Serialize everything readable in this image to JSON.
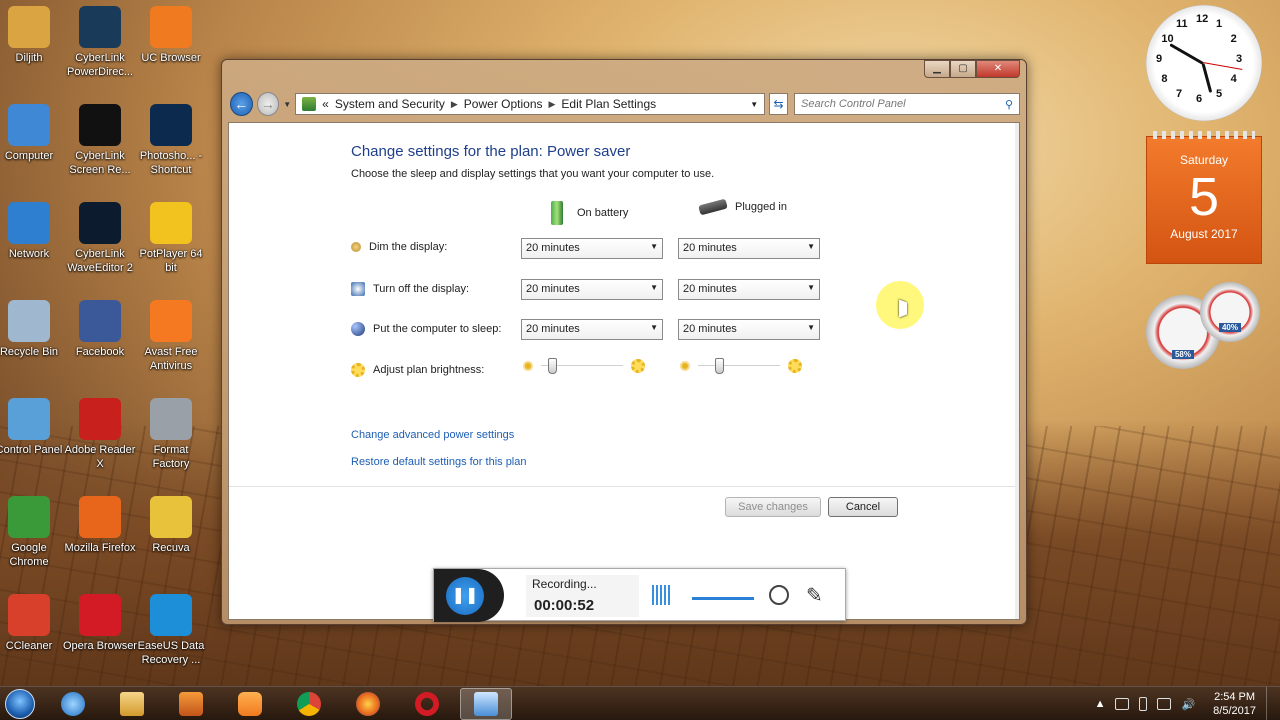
{
  "desktop": {
    "icons": [
      {
        "label": "Diljith",
        "color": "#d9a441"
      },
      {
        "label": "CyberLink PowerDirec...",
        "color": "#1a3a5a"
      },
      {
        "label": "UC Browser",
        "color": "#f07a1f"
      },
      {
        "label": "Computer",
        "color": "#3f88d6"
      },
      {
        "label": "CyberLink Screen Re...",
        "color": "#111111"
      },
      {
        "label": "Photosho... - Shortcut",
        "color": "#0b2a4d"
      },
      {
        "label": "Network",
        "color": "#2f7fd0"
      },
      {
        "label": "CyberLink WaveEditor 2",
        "color": "#0d1b2f"
      },
      {
        "label": "PotPlayer 64 bit",
        "color": "#f2c21f"
      },
      {
        "label": "Recycle Bin",
        "color": "#9fb7cf"
      },
      {
        "label": "Facebook",
        "color": "#3b5998"
      },
      {
        "label": "Avast Free Antivirus",
        "color": "#f47920"
      },
      {
        "label": "Control Panel",
        "color": "#5aa0d8"
      },
      {
        "label": "Adobe Reader X",
        "color": "#c8211d"
      },
      {
        "label": "Format Factory",
        "color": "#9aa0a8"
      },
      {
        "label": "Google Chrome",
        "color": "#3a9a3a"
      },
      {
        "label": "Mozilla Firefox",
        "color": "#e8661c"
      },
      {
        "label": "Recuva",
        "color": "#e8c23a"
      },
      {
        "label": "CCleaner",
        "color": "#d8402c"
      },
      {
        "label": "Opera Browser",
        "color": "#d21b24"
      },
      {
        "label": "EaseUS Data Recovery ...",
        "color": "#1d8ed8"
      }
    ]
  },
  "window": {
    "caption": {
      "minimize": "▁",
      "maximize": "▢",
      "close": "✕"
    },
    "breadcrumb": [
      "System and Security",
      "Power Options",
      "Edit Plan Settings"
    ],
    "breadcrumb_prefix": "«",
    "search_placeholder": "Search Control Panel",
    "title": "Change settings for the plan: Power saver",
    "subtitle": "Choose the sleep and display settings that you want your computer to use.",
    "col_battery": "On battery",
    "col_plugged": "Plugged in",
    "rows": [
      {
        "label": "Dim the display:",
        "battery": "20 minutes",
        "plugged": "20 minutes"
      },
      {
        "label": "Turn off the display:",
        "battery": "20 minutes",
        "plugged": "20 minutes"
      },
      {
        "label": "Put the computer to sleep:",
        "battery": "20 minutes",
        "plugged": "20 minutes"
      }
    ],
    "brightness_label": "Adjust plan brightness:",
    "brightness_battery": 0.1,
    "brightness_plugged": 0.23,
    "link_advanced": "Change advanced power settings",
    "link_restore": "Restore default settings for this plan",
    "btn_save": "Save changes",
    "btn_cancel": "Cancel"
  },
  "recorder": {
    "status": "Recording...",
    "time": "00:00:52"
  },
  "gadgets": {
    "calendar": {
      "day": "Saturday",
      "date": "5",
      "month": "August 2017"
    },
    "clock_numbers": [
      "12",
      "1",
      "2",
      "3",
      "4",
      "5",
      "6",
      "7",
      "8",
      "9",
      "10",
      "11"
    ],
    "meter_cpu": "58%",
    "meter_ram": "40%"
  },
  "taskbar": {
    "time": "2:54 PM",
    "date": "8/5/2017"
  },
  "colors": {
    "accent": "#1e3f8a",
    "link": "#1e5fb4"
  }
}
